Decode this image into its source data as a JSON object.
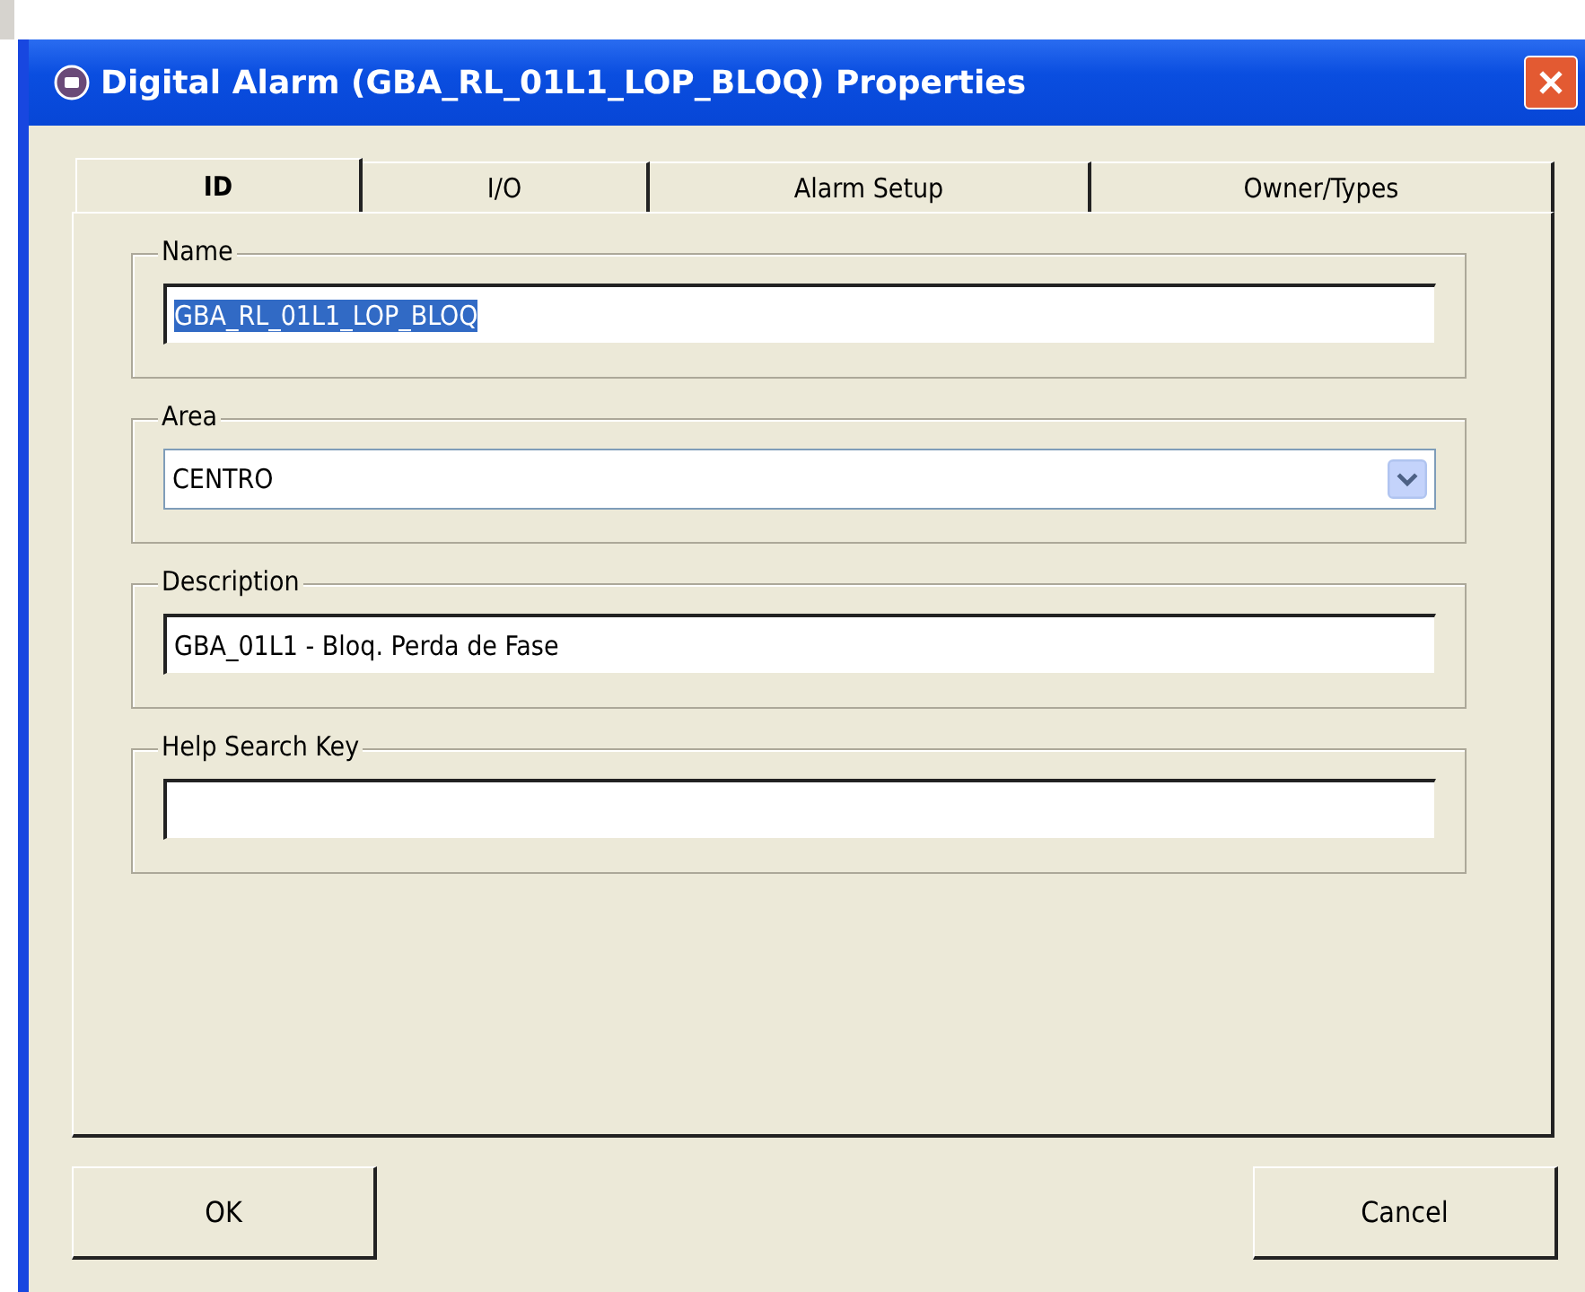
{
  "window": {
    "title": "Digital Alarm (GBA_RL_01L1_LOP_BLOQ) Properties"
  },
  "tabs": [
    {
      "label": "ID",
      "selected": true
    },
    {
      "label": "I/O",
      "selected": false
    },
    {
      "label": "Alarm Setup",
      "selected": false
    },
    {
      "label": "Owner/Types",
      "selected": false
    }
  ],
  "fields": [
    {
      "label": "Name",
      "kind": "text",
      "value": "GBA_RL_01L1_LOP_BLOQ",
      "text_selected": true
    },
    {
      "label": "Area",
      "kind": "dropdown",
      "value": "CENTRO"
    },
    {
      "label": "Description",
      "kind": "text",
      "value": "GBA_01L1 - Bloq. Perda de Fase"
    },
    {
      "label": "Help Search Key",
      "kind": "text"
    }
  ],
  "buttons": [
    "OK",
    "Cancel"
  ]
}
